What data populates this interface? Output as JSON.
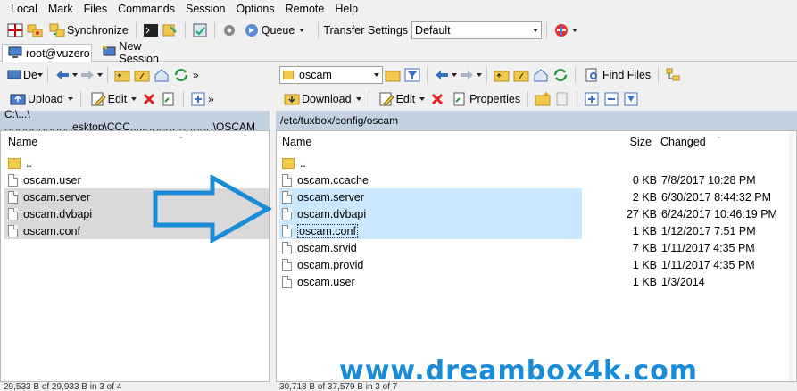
{
  "menu": [
    "Local",
    "Mark",
    "Files",
    "Commands",
    "Session",
    "Options",
    "Remote",
    "Help"
  ],
  "toolbar1": {
    "synchronize": "Synchronize",
    "queue": "Queue",
    "transfer_settings": "Transfer Settings",
    "transfer_value": "Default"
  },
  "tabs": {
    "session": "root@vuzero",
    "new_session": "New Session"
  },
  "left": {
    "drive": "De",
    "upload": "Upload",
    "edit": "Edit",
    "path": "C:\\...\\ ␣␣␣␣␣␣␣␣␣␣esktop\\CCC.....␣␣␣␣␣␣␣␣␣␣\\OSCAM",
    "col_name": "Name",
    "files": [
      {
        "name": "..",
        "type": "up"
      },
      {
        "name": "oscam.user",
        "type": "file"
      },
      {
        "name": "oscam.server",
        "type": "file"
      },
      {
        "name": "oscam.dvbapi",
        "type": "file"
      },
      {
        "name": "oscam.conf",
        "type": "file"
      }
    ],
    "status": "29,533 B of 29,933 B in 3 of 4"
  },
  "right": {
    "folder": "oscam",
    "find_files": "Find Files",
    "download": "Download",
    "edit": "Edit",
    "properties": "Properties",
    "path": "/etc/tuxbox/config/oscam",
    "col_name": "Name",
    "col_size": "Size",
    "col_changed": "Changed",
    "files": [
      {
        "name": "..",
        "size": "",
        "changed": "",
        "type": "up"
      },
      {
        "name": "oscam.ccache",
        "size": "0 KB",
        "changed": "7/8/2017 10:28 PM",
        "type": "file"
      },
      {
        "name": "oscam.server",
        "size": "2 KB",
        "changed": "6/30/2017 8:44:32 PM",
        "type": "file"
      },
      {
        "name": "oscam.dvbapi",
        "size": "27 KB",
        "changed": "6/24/2017 10:46:19 PM",
        "type": "file"
      },
      {
        "name": "oscam.conf",
        "size": "1 KB",
        "changed": "1/12/2017 7:51 PM",
        "type": "file"
      },
      {
        "name": "oscam.srvid",
        "size": "7 KB",
        "changed": "1/11/2017 4:35 PM",
        "type": "file"
      },
      {
        "name": "oscam.provid",
        "size": "1 KB",
        "changed": "1/11/2017 4:35 PM",
        "type": "file"
      },
      {
        "name": "oscam.user",
        "size": "1 KB",
        "changed": "1/3/2014",
        "type": "file"
      }
    ],
    "status": "30,718 B of 37,579 B in 3 of 7"
  },
  "watermark": "www.dreambox4k.com",
  "colors": {
    "path_bar": "#c3d1e1",
    "selection": "#cce8ff",
    "arrow": "#1a8bd6"
  }
}
